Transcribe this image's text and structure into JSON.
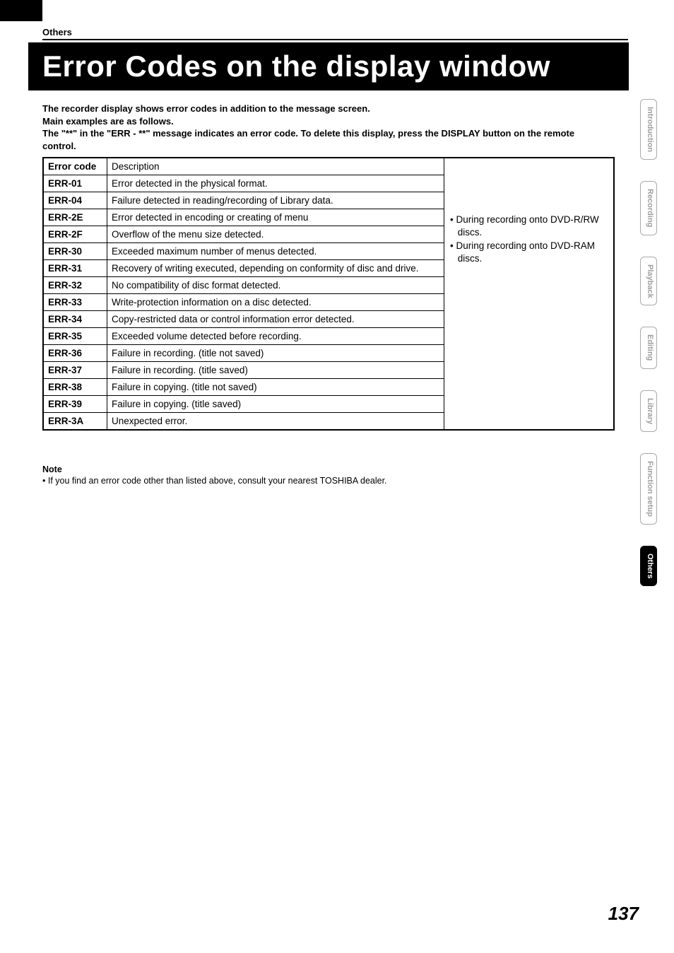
{
  "section_label": "Others",
  "title": "Error Codes on the display window",
  "intro_lines": [
    "The recorder display shows error codes in addition to the message screen.",
    "Main examples are as follows.",
    "The \"**\" in the \"ERR - **\" message indicates an error code. To delete this display, press the DISPLAY button on the remote control."
  ],
  "table": {
    "header_code": "Error code",
    "header_desc": "Description",
    "rows": [
      {
        "code": "ERR-01",
        "desc": "Error detected in the physical format."
      },
      {
        "code": "ERR-04",
        "desc": "Failure detected in reading/recording of Library data."
      },
      {
        "code": "ERR-2E",
        "desc": "Error detected in encoding or creating of menu"
      },
      {
        "code": "ERR-2F",
        "desc": "Overflow of the menu size detected."
      },
      {
        "code": "ERR-30",
        "desc": "Exceeded maximum number of menus detected."
      },
      {
        "code": "ERR-31",
        "desc": "Recovery of writing executed, depending on conformity of disc and drive."
      },
      {
        "code": "ERR-32",
        "desc": "No compatibility of disc format detected."
      },
      {
        "code": "ERR-33",
        "desc": "Write-protection information on a disc detected."
      },
      {
        "code": "ERR-34",
        "desc": "Copy-restricted data or control information error detected."
      },
      {
        "code": "ERR-35",
        "desc": "Exceeded volume detected before recording."
      },
      {
        "code": "ERR-36",
        "desc": "Failure in recording. (title not saved)"
      },
      {
        "code": "ERR-37",
        "desc": "Failure in recording. (title saved)"
      },
      {
        "code": "ERR-38",
        "desc": "Failure in copying. (title not saved)"
      },
      {
        "code": "ERR-39",
        "desc": "Failure in copying. (title saved)"
      },
      {
        "code": "ERR-3A",
        "desc": "Unexpected error."
      }
    ],
    "side_notes": [
      "• During recording onto DVD-R/RW discs.",
      "• During recording onto DVD-RAM discs."
    ]
  },
  "note": {
    "label": "Note",
    "body": "• If you find an error code other than listed above, consult your nearest TOSHIBA dealer."
  },
  "tabs": [
    {
      "label": "Introduction",
      "active": false
    },
    {
      "label": "Recording",
      "active": false
    },
    {
      "label": "Playback",
      "active": false
    },
    {
      "label": "Editing",
      "active": false
    },
    {
      "label": "Library",
      "active": false
    },
    {
      "label": "Function setup",
      "active": false
    },
    {
      "label": "Others",
      "active": true
    }
  ],
  "page_number": "137"
}
